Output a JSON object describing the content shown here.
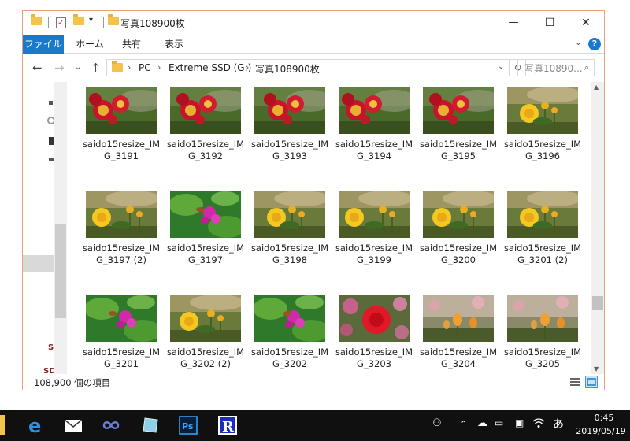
{
  "window": {
    "title": "写真108900枚",
    "minimize_glyph": "—",
    "maximize_glyph": "☐",
    "close_glyph": "✕"
  },
  "ribbon": {
    "tabs": [
      "ファイル",
      "ホーム",
      "共有",
      "表示"
    ],
    "help_glyph": "?",
    "expand_glyph": "⌄"
  },
  "address": {
    "crumbs": [
      "PC",
      "Extreme SSD (G:)",
      "写真108900枚"
    ],
    "search_placeholder": "写真10890..."
  },
  "items": [
    {
      "name": "saido15resize_IMG_3191",
      "kind": "red"
    },
    {
      "name": "saido15resize_IMG_3192",
      "kind": "red"
    },
    {
      "name": "saido15resize_IMG_3193",
      "kind": "red"
    },
    {
      "name": "saido15resize_IMG_3194",
      "kind": "red"
    },
    {
      "name": "saido15resize_IMG_3195",
      "kind": "red"
    },
    {
      "name": "saido15resize_IMG_3196",
      "kind": "yellow"
    },
    {
      "name": "saido15resize_IMG_3197 (2)",
      "kind": "yellow"
    },
    {
      "name": "saido15resize_IMG_3197",
      "kind": "pink"
    },
    {
      "name": "saido15resize_IMG_3198",
      "kind": "yellow"
    },
    {
      "name": "saido15resize_IMG_3199",
      "kind": "yellow"
    },
    {
      "name": "saido15resize_IMG_3200",
      "kind": "yellow"
    },
    {
      "name": "saido15resize_IMG_3201 (2)",
      "kind": "yellow"
    },
    {
      "name": "saido15resize_IMG_3201",
      "kind": "pink"
    },
    {
      "name": "saido15resize_IMG_3202 (2)",
      "kind": "yellow"
    },
    {
      "name": "saido15resize_IMG_3202",
      "kind": "pink"
    },
    {
      "name": "saido15resize_IMG_3203",
      "kind": "redbig"
    },
    {
      "name": "saido15resize_IMG_3204",
      "kind": "buds"
    },
    {
      "name": "saido15resize_IMG_3205",
      "kind": "buds"
    }
  ],
  "status": {
    "count_text": "108,900 個の項目"
  },
  "taskbar": {
    "time": "0:45",
    "date": "2019/05/19",
    "ime": "あ"
  },
  "colors": {
    "accent": "#1979ca",
    "window_border": "#e7a07c"
  }
}
